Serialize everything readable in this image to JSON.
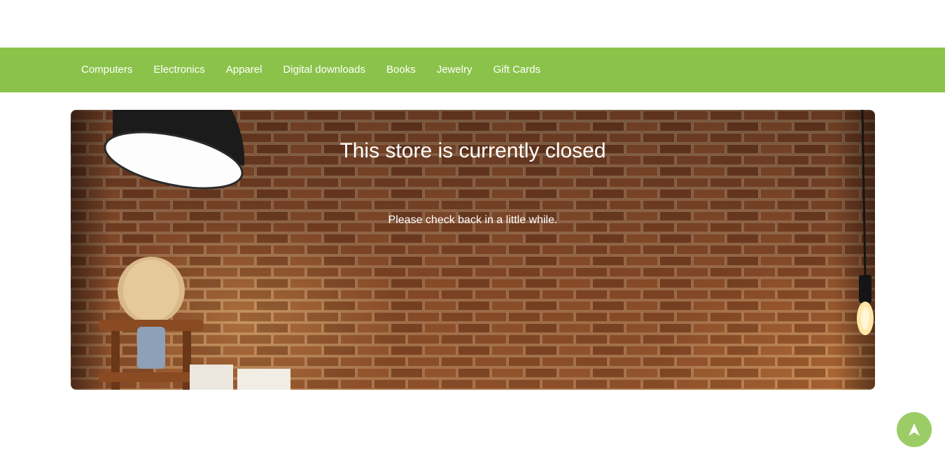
{
  "nav": {
    "items": [
      {
        "label": "Computers"
      },
      {
        "label": "Electronics"
      },
      {
        "label": "Apparel"
      },
      {
        "label": "Digital downloads"
      },
      {
        "label": "Books"
      },
      {
        "label": "Jewelry"
      },
      {
        "label": "Gift Cards"
      }
    ]
  },
  "hero": {
    "title": "This store is currently closed",
    "message": "Please check back in a little while."
  },
  "scroll_top": {
    "icon": "arrow-up-icon"
  },
  "colors": {
    "nav_background": "#8bc34a",
    "scroll_top_background": "#9ccc65"
  }
}
